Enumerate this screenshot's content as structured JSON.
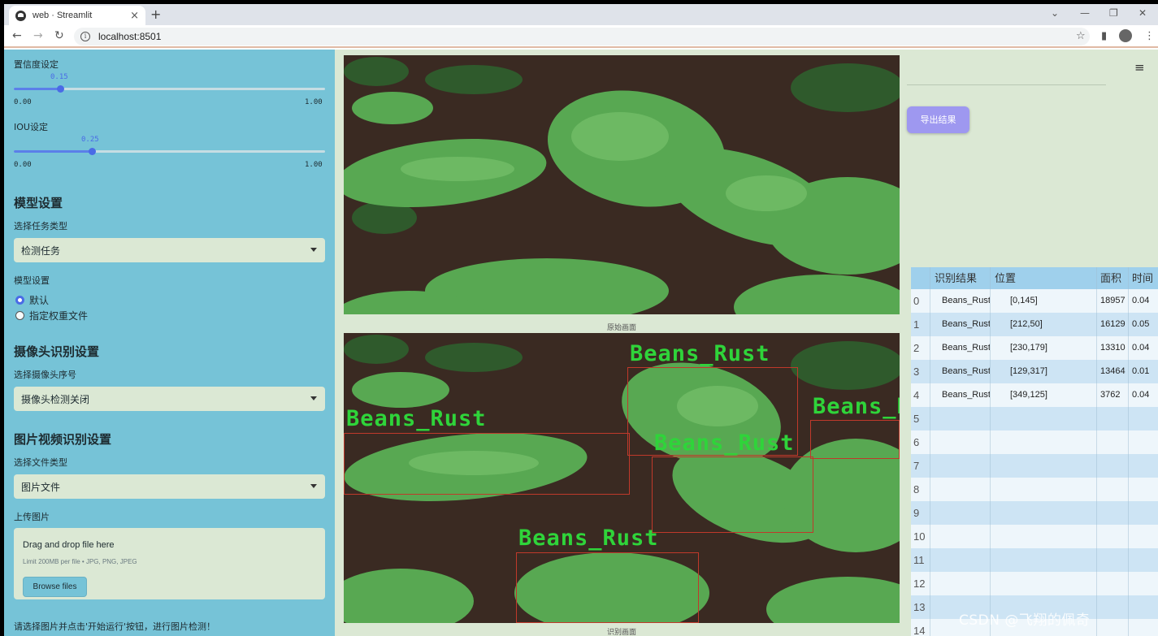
{
  "browser": {
    "tab_title": "web · Streamlit",
    "url": "localhost:8501",
    "tab_close": "×",
    "new_tab": "+",
    "minimize": "⌄",
    "minimize2": "—",
    "restore": "❐",
    "close": "✕",
    "back": "←",
    "forward": "→",
    "reload": "↻",
    "info": "i",
    "star": "☆",
    "sidepanel": "▮",
    "menu": "⋮"
  },
  "sidebar": {
    "confidence": {
      "label": "置信度设定",
      "value": "0.15",
      "fraction": 0.15,
      "min": "0.00",
      "max": "1.00"
    },
    "iou": {
      "label": "IOU设定",
      "value": "0.25",
      "fraction": 0.25,
      "min": "0.00",
      "max": "1.00"
    },
    "model_header": "模型设置",
    "task_label": "选择任务类型",
    "task_value": "检测任务",
    "model_label": "模型设置",
    "model_options": [
      "默认",
      "指定权重文件"
    ],
    "model_selected": 0,
    "camera_header": "摄像头识别设置",
    "camera_label": "选择摄像头序号",
    "camera_value": "摄像头检测关闭",
    "media_header": "图片视频识别设置",
    "filetype_label": "选择文件类型",
    "filetype_value": "图片文件",
    "upload_label": "上传图片",
    "upload_title": "Drag and drop file here",
    "upload_limit": "Limit 200MB per file • JPG, PNG, JPEG",
    "browse_label": "Browse files",
    "hint": "请选择图片并点击'开始运行'按钮，进行图片检测！"
  },
  "main": {
    "menu_icon": "≡",
    "original_caption": "原始画面",
    "result_caption": "识别画面",
    "export_label": "导出结果",
    "detection_label": "Beans_Rust",
    "colors": {
      "sidebar_bg": "#76c3d7",
      "main_bg": "#dbe8d4",
      "accent": "#4a6be6",
      "box": "#c0392b",
      "label": "#2fd43a",
      "export": "#9e98f0"
    },
    "table": {
      "columns": [
        "",
        "识别结果",
        "位置",
        "面积",
        "时间"
      ],
      "rows": [
        [
          "0",
          "Beans_Rust",
          "[0,145]",
          "18957",
          "0.04"
        ],
        [
          "1",
          "Beans_Rust",
          "[212,50]",
          "16129",
          "0.05"
        ],
        [
          "2",
          "Beans_Rust",
          "[230,179]",
          "13310",
          "0.04"
        ],
        [
          "3",
          "Beans_Rust",
          "[129,317]",
          "13464",
          "0.01"
        ],
        [
          "4",
          "Beans_Rust",
          "[349,125]",
          "3762",
          "0.04"
        ]
      ],
      "empty_indices": [
        "5",
        "6",
        "7",
        "8",
        "9",
        "10",
        "11",
        "12",
        "13",
        "14"
      ]
    },
    "watermark": "CSDN @飞翔的佩奇"
  }
}
